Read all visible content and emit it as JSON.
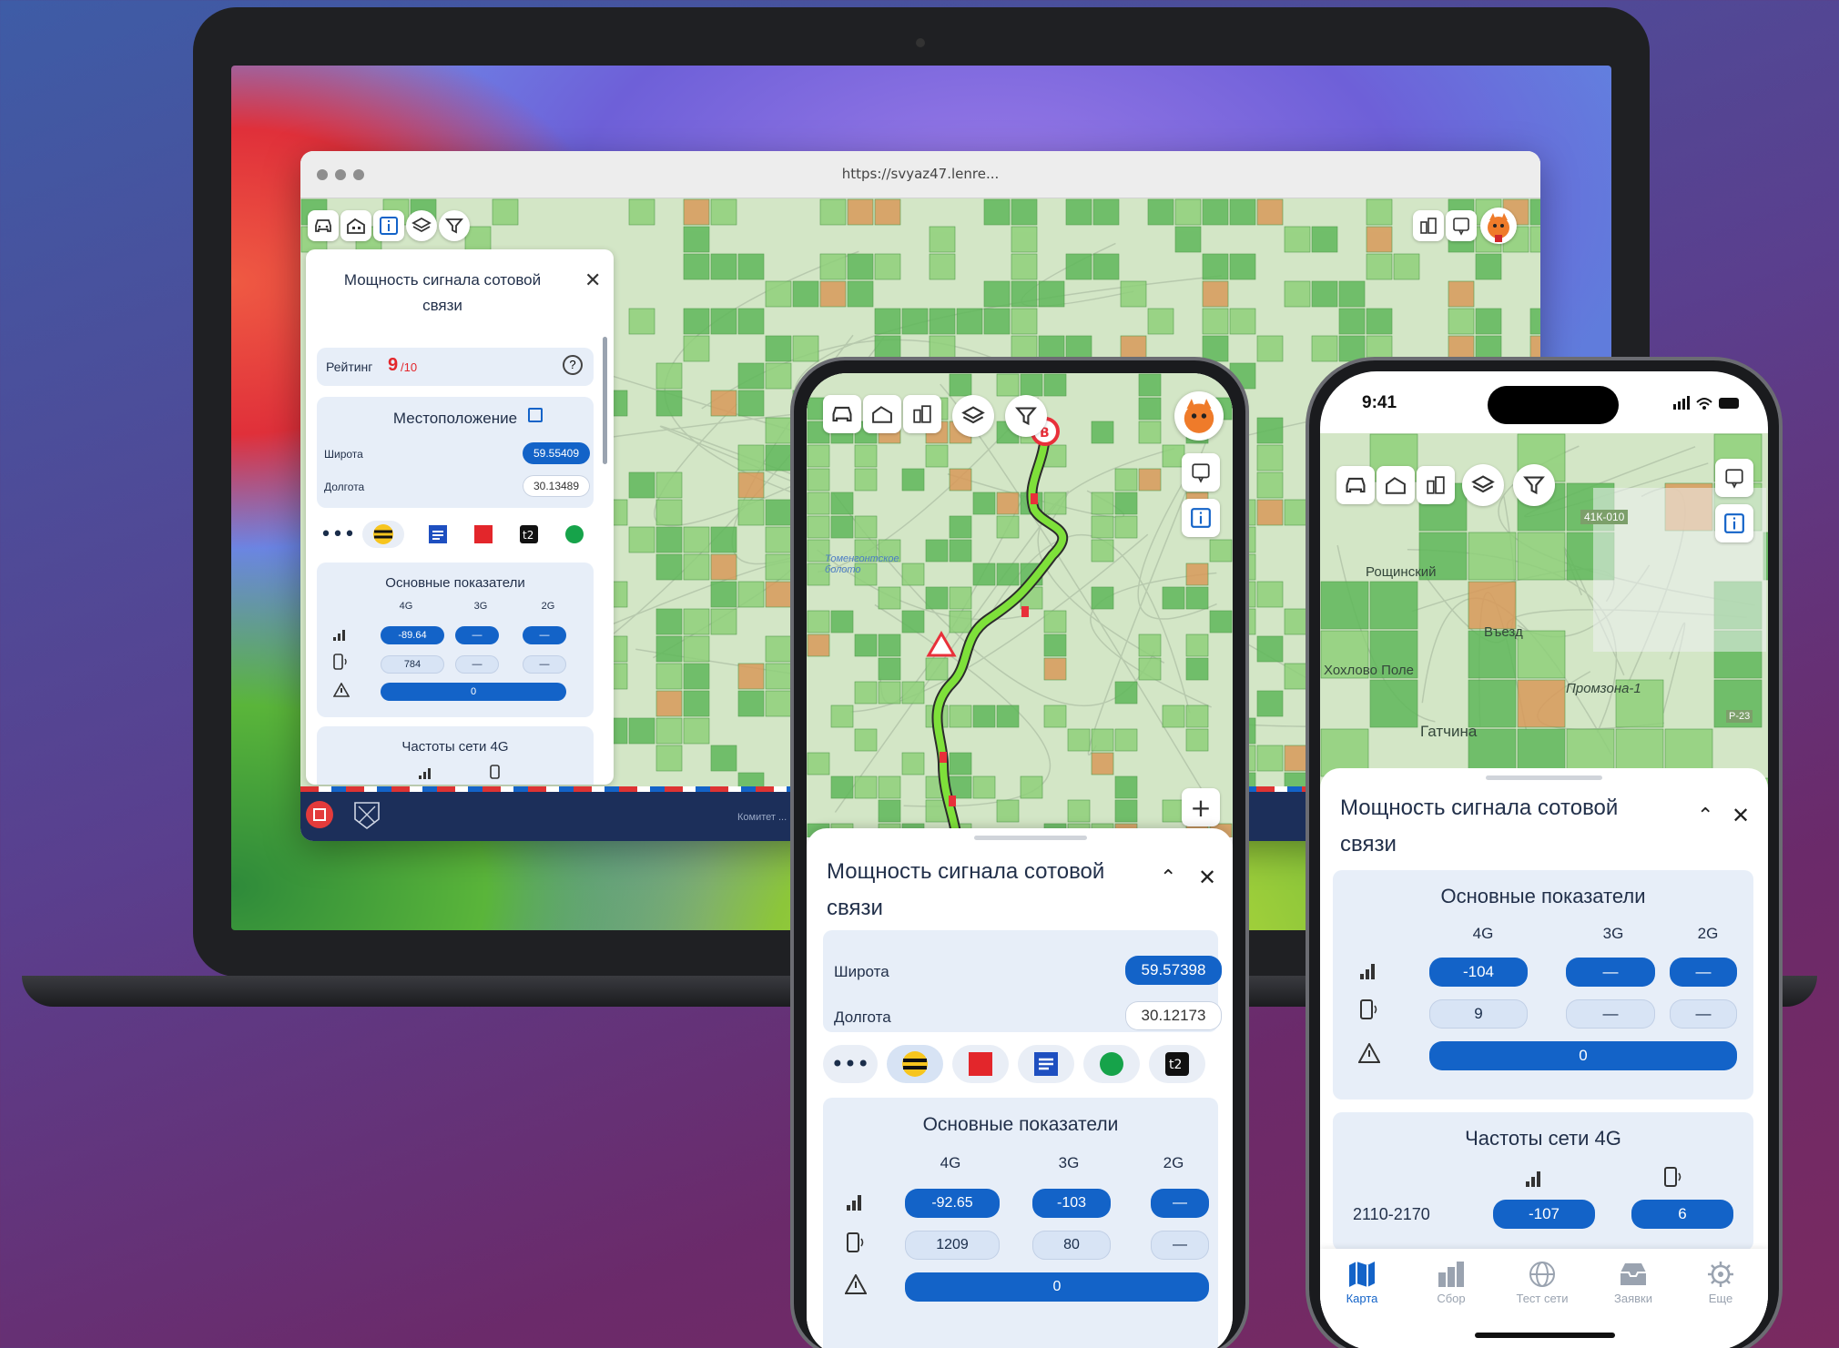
{
  "browser": {
    "url": "https://svyaz47.lenre..."
  },
  "desktop": {
    "panel_title_1": "Мощность сигнала сотовой",
    "panel_title_2": "связи",
    "rating_label": "Рейтинг",
    "rating_value": "9",
    "rating_max": "/10",
    "location_title": "Местоположение",
    "lat_label": "Широта",
    "lat_value": "59.55409",
    "lon_label": "Долгота",
    "lon_value": "30.13489",
    "main_title": "Основные показатели",
    "cols": [
      "4G",
      "3G",
      "2G"
    ],
    "signal": [
      "-89.64",
      "—",
      "—"
    ],
    "devices": [
      "784",
      "—",
      "—"
    ],
    "alerts": "0",
    "freq_title": "Частоты сети 4G",
    "footer_text": "Комитет ..."
  },
  "android": {
    "panel_title_1": "Мощность сигнала сотовой",
    "panel_title_2": "связи",
    "lat_label": "Широта",
    "lat_value": "59.57398",
    "lon_label": "Долгота",
    "lon_value": "30.12173",
    "main_title": "Основные показатели",
    "cols": [
      "4G",
      "3G",
      "2G"
    ],
    "signal": [
      "-92.65",
      "-103",
      "—"
    ],
    "devices": [
      "1209",
      "80",
      "—"
    ],
    "alerts": "0",
    "map_label": "Томенгонтское болото",
    "marker_letter": "B",
    "zoom_in": "+"
  },
  "iphone": {
    "time": "9:41",
    "panel_title_1": "Мощность сигнала сотовой",
    "panel_title_2": "связи",
    "main_title": "Основные показатели",
    "cols": [
      "4G",
      "3G",
      "2G"
    ],
    "signal": [
      "-104",
      "—",
      "—"
    ],
    "devices": [
      "9",
      "—",
      "—"
    ],
    "alerts": "0",
    "freq_title": "Частоты сети 4G",
    "freq_range": "2110-2170",
    "freq_signal": "-107",
    "freq_devices": "6",
    "map_labels": [
      "Рощинский",
      "Въезд",
      "Хохлово Поле",
      "Промзона-1",
      "Гатчина",
      "41К-010",
      "Р-23"
    ],
    "nav": [
      "Карта",
      "Сбор",
      "Тест сети",
      "Заявки",
      "Еще"
    ]
  },
  "colors": {
    "accent": "#1363c8",
    "grid_green": "#5fb85a",
    "grid_orange": "#d89a5a",
    "route_green": "#7ee03a",
    "route_red": "#e8303a"
  }
}
